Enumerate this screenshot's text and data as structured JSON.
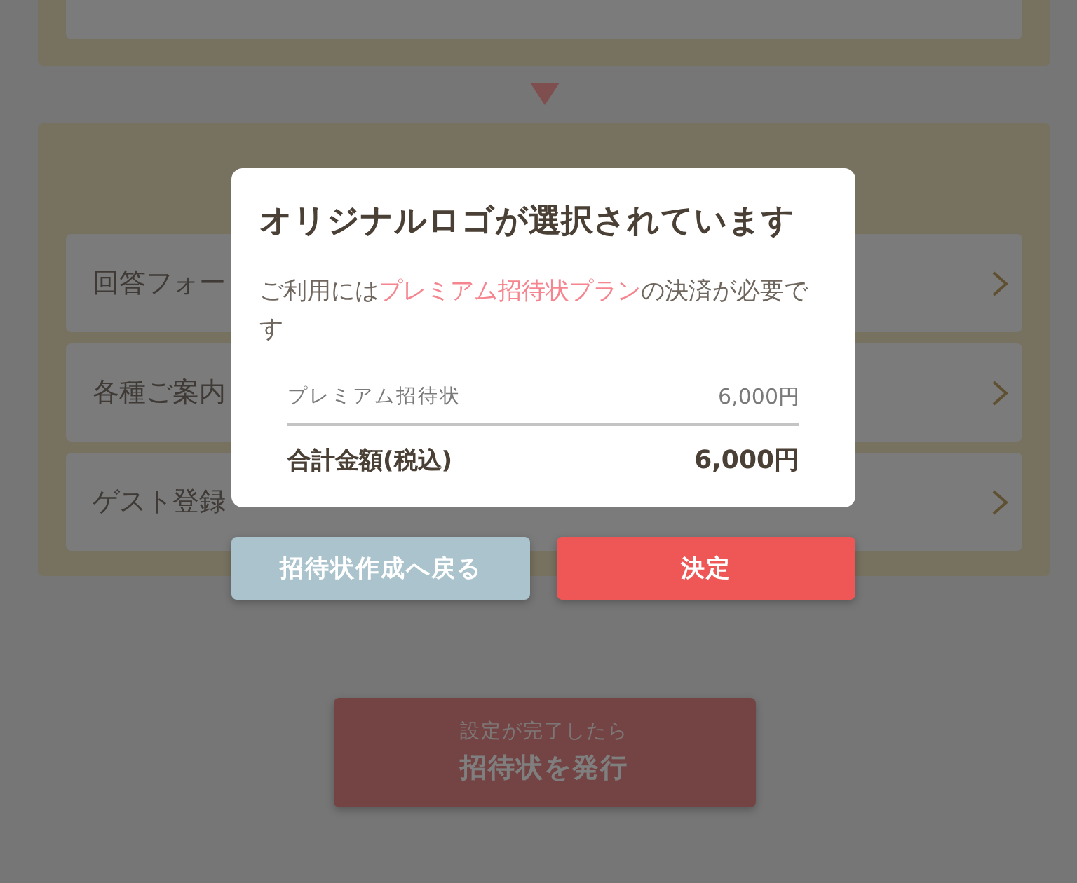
{
  "option_section": {
    "rows": [
      {
        "label": "回答フォー"
      },
      {
        "label": "各種ご案内"
      },
      {
        "label": "ゲスト登録"
      }
    ]
  },
  "issue_button": {
    "caption": "設定が完了したら",
    "label": "招待状を発行"
  },
  "dialog": {
    "title": "オリジナルロゴが選択されています",
    "message": [
      {
        "text": "ご利用には",
        "highlight": false
      },
      {
        "text": "プレミアム招待状プラン",
        "highlight": true
      },
      {
        "text": "の決済が必要です",
        "highlight": false
      }
    ],
    "items": [
      {
        "name": "プレミアム招待状",
        "price": "6,000円"
      }
    ],
    "total": {
      "label": "合計金額(税込)",
      "price": "6,000円"
    },
    "buttons": [
      {
        "label": "招待状作成へ戻る",
        "kind": "secondary"
      },
      {
        "label": "決定",
        "kind": "primary"
      }
    ]
  }
}
